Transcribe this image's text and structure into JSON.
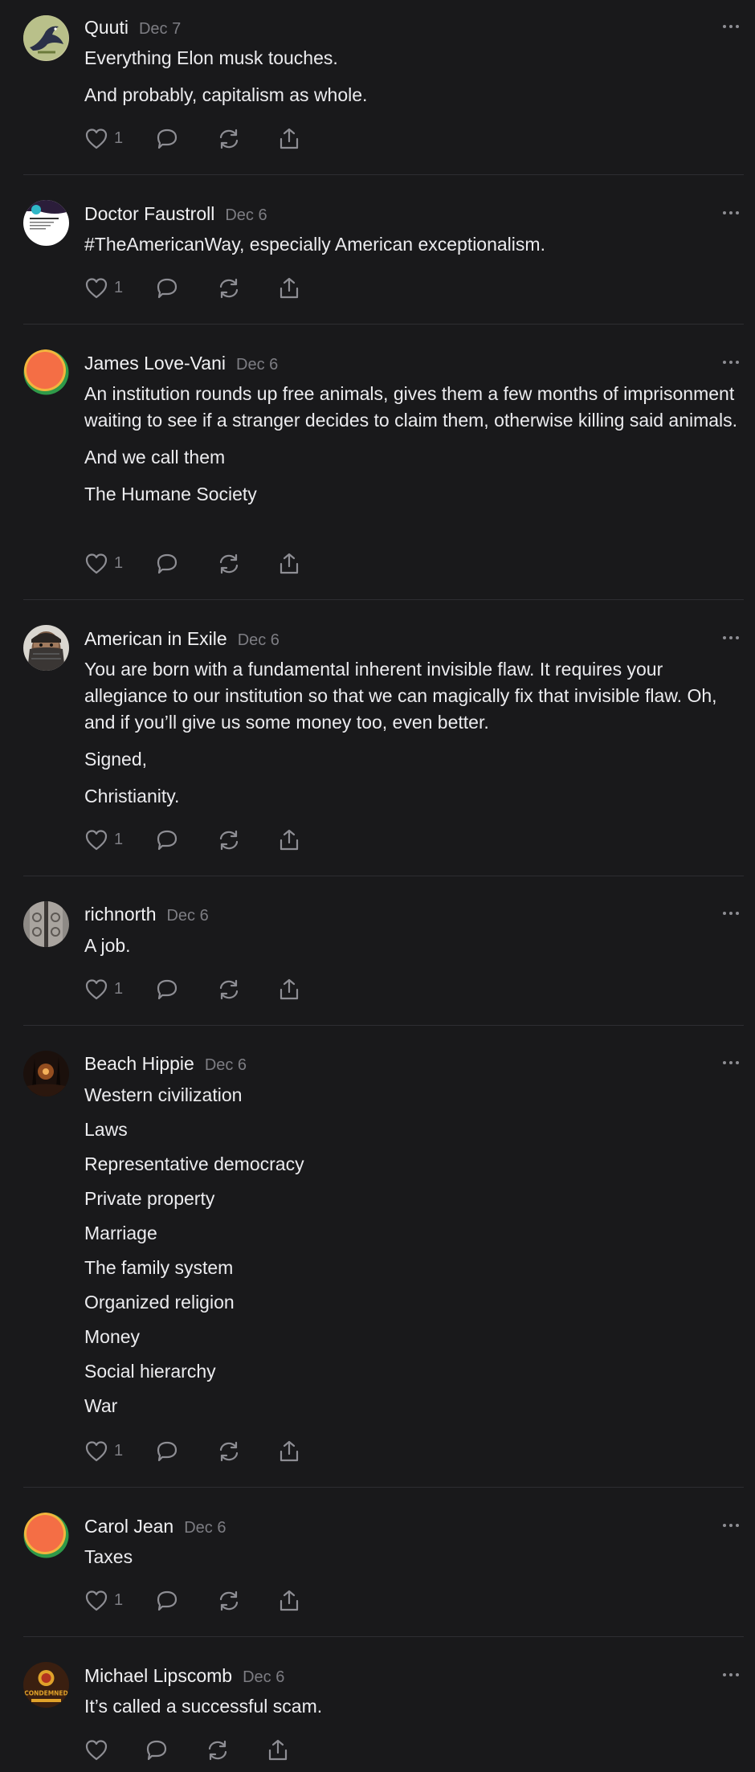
{
  "posts": [
    {
      "author": "Quuti",
      "date": "Dec 7",
      "paragraphs": [
        "Everything Elon musk touches.",
        "And probably, capitalism as whole."
      ],
      "likes": "1",
      "avatar": "bird-avatar"
    },
    {
      "author": "Doctor Faustroll",
      "date": "Dec 6",
      "paragraphs": [
        "#TheAmericanWay, especially American exceptionalism."
      ],
      "likes": "1",
      "avatar": "document-avatar"
    },
    {
      "author": "James Love-Vani",
      "date": "Dec 6",
      "paragraphs": [
        "An institution rounds up free animals, gives them a few months of imprisonment waiting to see if a stranger decides to claim them, otherwise killing said animals.",
        "And we call them",
        "The Humane Society"
      ],
      "likes": "1",
      "avatar": "orange-circle-avatar"
    },
    {
      "author": "American in Exile",
      "date": "Dec 6",
      "paragraphs": [
        "You are born with a fundamental inherent invisible flaw. It requires your allegiance to our institution so that we can magically fix that invisible flaw. Oh, and if you’ll give us some money too, even better.",
        "Signed,",
        "Christianity."
      ],
      "likes": "1",
      "avatar": "masked-man-avatar"
    },
    {
      "author": "richnorth",
      "date": "Dec 6",
      "paragraphs": [
        "A job."
      ],
      "likes": "1",
      "avatar": "ornate-door-avatar"
    },
    {
      "author": "Beach Hippie",
      "date": "Dec 6",
      "paragraphs": [
        "Western civilization",
        "Laws",
        "Representative democracy",
        "Private property",
        "Marriage",
        "The family system",
        "Organized religion",
        "Money",
        "Social hierarchy",
        "War"
      ],
      "likes": "1",
      "avatar": "dark-forest-avatar"
    },
    {
      "author": "Carol Jean",
      "date": "Dec 6",
      "paragraphs": [
        "Taxes"
      ],
      "likes": "1",
      "avatar": "orange-circle-avatar"
    },
    {
      "author": "Michael Lipscomb",
      "date": "Dec 6",
      "paragraphs": [
        "It’s called a successful scam."
      ],
      "likes": "",
      "avatar": "condemned-badge-avatar",
      "avatar_text": "CONDEMNED"
    }
  ],
  "colors": {
    "background": "#19191b",
    "text": "#f1f1f3",
    "muted": "#7d7d83",
    "divider": "#2e2e32"
  }
}
